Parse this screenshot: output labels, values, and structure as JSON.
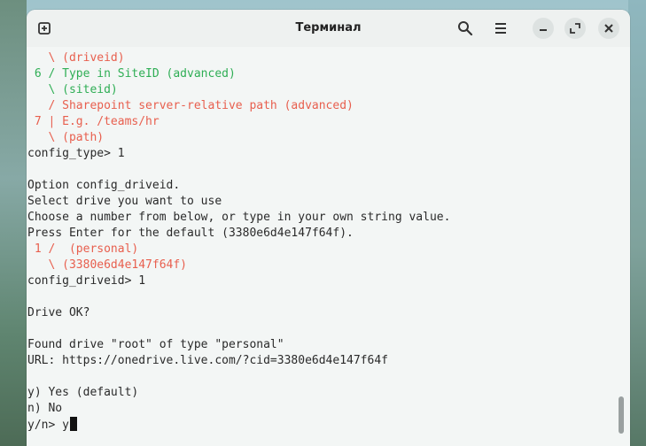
{
  "window": {
    "title": "Терминал"
  },
  "terminal": {
    "lines": [
      {
        "text": "   \\ (driveid)",
        "color": "red"
      },
      {
        "text": " 6 / Type in SiteID (advanced)",
        "color": "green"
      },
      {
        "text": "   \\ (siteid)",
        "color": "green"
      },
      {
        "text": "   / Sharepoint server-relative path (advanced)",
        "color": "red"
      },
      {
        "text": " 7 | E.g. /teams/hr",
        "color": "red"
      },
      {
        "text": "   \\ (path)",
        "color": "red"
      },
      {
        "text": "config_type> 1",
        "color": "default"
      },
      {
        "text": "",
        "color": "default"
      },
      {
        "text": "Option config_driveid.",
        "color": "default"
      },
      {
        "text": "Select drive you want to use",
        "color": "default"
      },
      {
        "text": "Choose a number from below, or type in your own string value.",
        "color": "default"
      },
      {
        "text": "Press Enter for the default (3380e6d4e147f64f).",
        "color": "default"
      },
      {
        "text": " 1 /  (personal)",
        "color": "red"
      },
      {
        "text": "   \\ (3380e6d4e147f64f)",
        "color": "red"
      },
      {
        "text": "config_driveid> 1",
        "color": "default"
      },
      {
        "text": "",
        "color": "default"
      },
      {
        "text": "Drive OK?",
        "color": "default"
      },
      {
        "text": "",
        "color": "default"
      },
      {
        "text": "Found drive \"root\" of type \"personal\"",
        "color": "default"
      },
      {
        "text": "URL: https://onedrive.live.com/?cid=3380e6d4e147f64f",
        "color": "default"
      },
      {
        "text": "",
        "color": "default"
      },
      {
        "text": "y) Yes (default)",
        "color": "default"
      },
      {
        "text": "n) No",
        "color": "default"
      }
    ],
    "prompt": "y/n> y"
  }
}
